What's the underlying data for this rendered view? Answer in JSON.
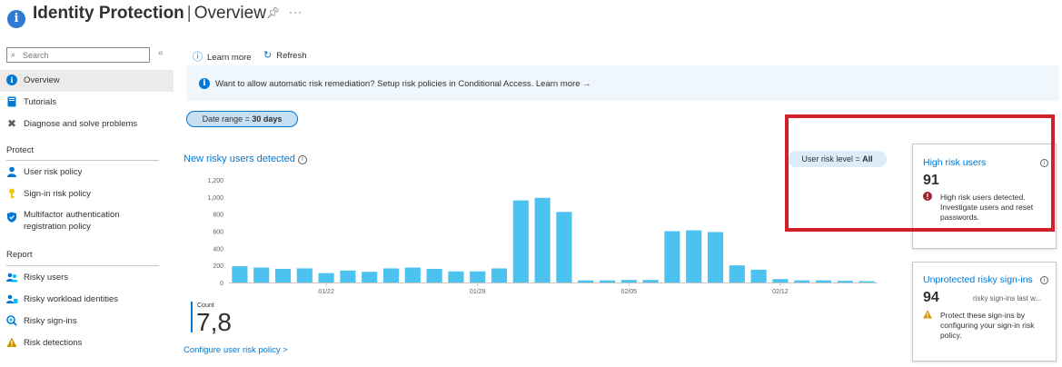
{
  "header": {
    "title_bold": "Identity Protection",
    "title_separator": "|",
    "title_rest": "Overview",
    "icons": [
      "info-icon",
      "pin-icon",
      "more-icon"
    ]
  },
  "sidebar": {
    "search_placeholder": "Search",
    "items": [
      {
        "label": "Overview",
        "icon": "info-icon",
        "active": true
      },
      {
        "label": "Tutorials",
        "icon": "book-icon"
      },
      {
        "label": "Diagnose and solve problems",
        "icon": "wrench-icon"
      }
    ],
    "protect_heading": "Protect",
    "protect_items": [
      {
        "label": "User risk policy",
        "icon": "user-icon"
      },
      {
        "label": "Sign-in risk policy",
        "icon": "key-icon"
      },
      {
        "label": "Multifactor authentication registration policy",
        "icon": "shield-icon"
      }
    ],
    "report_heading": "Report",
    "report_items": [
      {
        "label": "Risky users",
        "icon": "users-icon"
      },
      {
        "label": "Risky workload identities",
        "icon": "workload-icon"
      },
      {
        "label": "Risky sign-ins",
        "icon": "signin-icon"
      },
      {
        "label": "Risk detections",
        "icon": "warning-icon"
      }
    ]
  },
  "toolbar": {
    "learn_more": "Learn more",
    "refresh": "Refresh"
  },
  "banner": {
    "text": "Want to allow automatic risk remediation? Setup risk policies in Conditional Access. Learn more",
    "arrow": "→"
  },
  "date_range": {
    "label": "Date range = ",
    "value": "30 days"
  },
  "chart_section": {
    "title": "New risky users detected",
    "filter_label": "User risk level = ",
    "filter_value": "All",
    "count_label": "Count",
    "count_value": "7,8",
    "configure_link": "Configure user risk policy >"
  },
  "chart_data": {
    "type": "bar",
    "title": "New risky users detected",
    "ylim": [
      0,
      1200
    ],
    "yticks": [
      "0",
      "200",
      "400",
      "600",
      "800",
      "1,000",
      "1,200"
    ],
    "xtick_labels": [
      "01/22",
      "01/29",
      "02/05",
      "02/12"
    ],
    "xtick_indices": [
      4,
      11,
      18,
      25
    ],
    "values": [
      190,
      175,
      160,
      165,
      110,
      140,
      125,
      165,
      175,
      160,
      130,
      130,
      165,
      960,
      990,
      825,
      25,
      25,
      30,
      30,
      600,
      610,
      590,
      200,
      150,
      40,
      25,
      25,
      20,
      15
    ],
    "grid": false,
    "color": "#4cc2f1"
  },
  "cards": {
    "high_risk": {
      "title": "High risk users",
      "value": "91",
      "alert": "High risk users detected. Investigate users and reset passwords.",
      "alert_color": "#a4262c"
    },
    "unprotected": {
      "title": "Unprotected risky sign-ins",
      "value": "94",
      "sub": "risky sign-ins last w...",
      "alert": "Protect these sign-ins by configuring your sign-in risk policy.",
      "alert_color": "#d29200"
    }
  },
  "highlight_color": "#d0202a"
}
